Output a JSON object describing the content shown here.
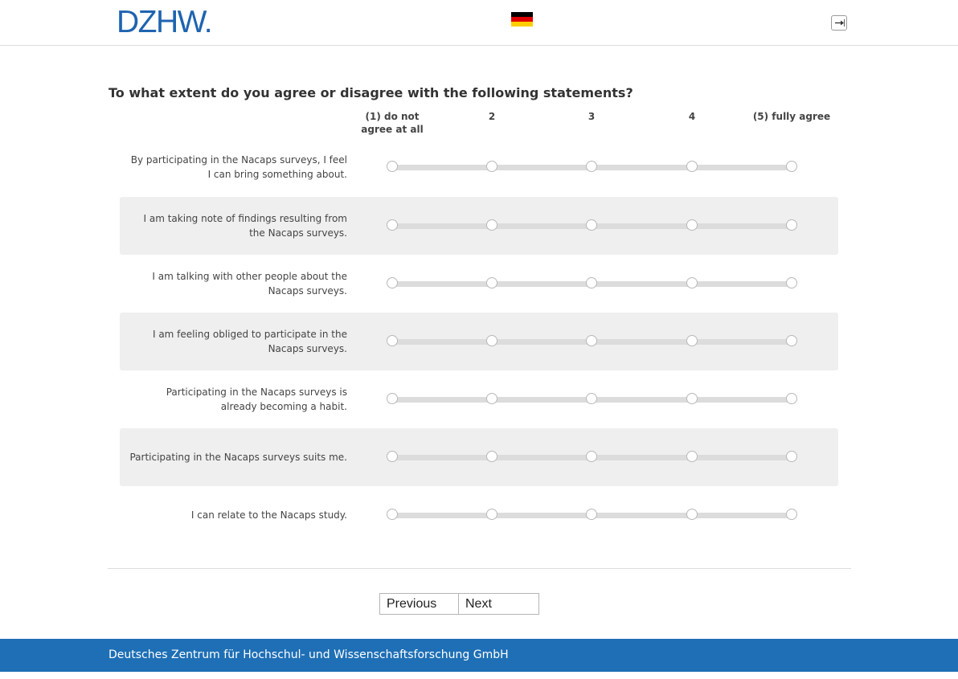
{
  "header": {
    "logo_text": "DZHW.",
    "language_flag": "flag-germany",
    "flag_colors": [
      "#000000",
      "#dd0000",
      "#ffce00"
    ],
    "logout_icon": "logout-icon"
  },
  "question": {
    "text": "To what extent do you agree or disagree with the following statements?",
    "scale": [
      "(1) do not agree at all",
      "2",
      "3",
      "4",
      "(5) fully agree"
    ],
    "items": [
      {
        "label": "By participating in the Nacaps surveys, I feel I can bring something about.",
        "selected": null
      },
      {
        "label": "I am taking note of findings resulting from the Nacaps surveys.",
        "selected": null
      },
      {
        "label": "I am talking with other people about the Nacaps surveys.",
        "selected": null
      },
      {
        "label": "I am feeling obliged to participate in the Nacaps surveys.",
        "selected": null
      },
      {
        "label": "Participating in the Nacaps surveys is already becoming a habit.",
        "selected": null
      },
      {
        "label": "Participating in the Nacaps surveys suits me.",
        "selected": null
      },
      {
        "label": "I can relate to the Nacaps study.",
        "selected": null
      }
    ]
  },
  "navigation": {
    "previous_label": "Previous",
    "next_label": "Next"
  },
  "footer": {
    "text": "Deutsches Zentrum für Hochschul- und Wissenschaftsforschung GmbH"
  },
  "colors": {
    "brand_blue": "#1e64b0",
    "footer_blue": "#1e6fb5",
    "row_shade": "#efefef"
  }
}
